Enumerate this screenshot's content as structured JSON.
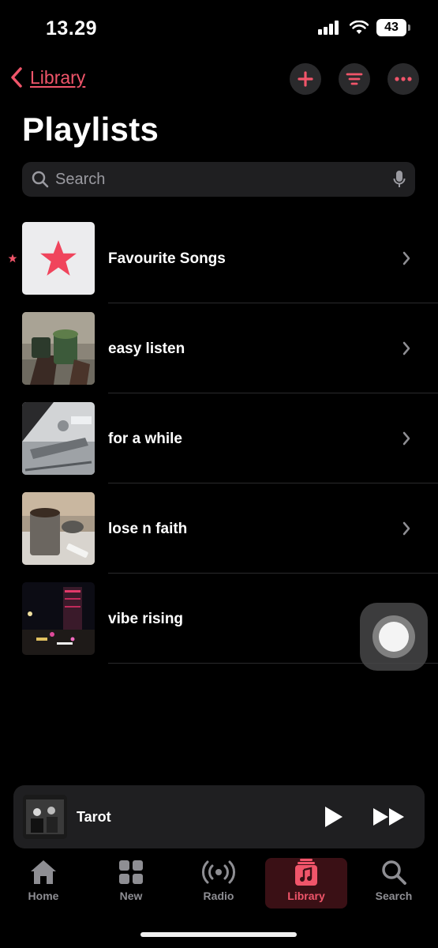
{
  "status_bar": {
    "time": "13.29",
    "battery": "43"
  },
  "nav": {
    "back_label": "Library",
    "add_icon": "plus-icon",
    "sort_icon": "sort-lines-icon",
    "more_icon": "ellipsis-icon"
  },
  "page_title": "Playlists",
  "search": {
    "placeholder": "Search",
    "value": ""
  },
  "playlists": [
    {
      "label": "Favourite Songs",
      "thumb": "star-artwork",
      "starred": true,
      "chevron": true
    },
    {
      "label": "easy listen",
      "thumb": "photo-drinks",
      "starred": false,
      "chevron": true
    },
    {
      "label": "for a while",
      "thumb": "photo-ceiling",
      "starred": false,
      "chevron": true
    },
    {
      "label": "lose n faith",
      "thumb": "photo-coffee",
      "starred": false,
      "chevron": true
    },
    {
      "label": "vibe rising",
      "thumb": "photo-night-city",
      "starred": false,
      "chevron": false
    }
  ],
  "mini_player": {
    "title": "Tarot"
  },
  "tabs": [
    {
      "label": "Home",
      "icon": "home-icon",
      "active": false
    },
    {
      "label": "New",
      "icon": "grid-icon",
      "active": false
    },
    {
      "label": "Radio",
      "icon": "radio-waves-icon",
      "active": false
    },
    {
      "label": "Library",
      "icon": "music-note-stack-icon",
      "active": true
    },
    {
      "label": "Search",
      "icon": "magnifier-icon",
      "active": false
    }
  ],
  "colors": {
    "accent": "#f0556a",
    "background": "#000000",
    "surface": "#1f1f21"
  }
}
